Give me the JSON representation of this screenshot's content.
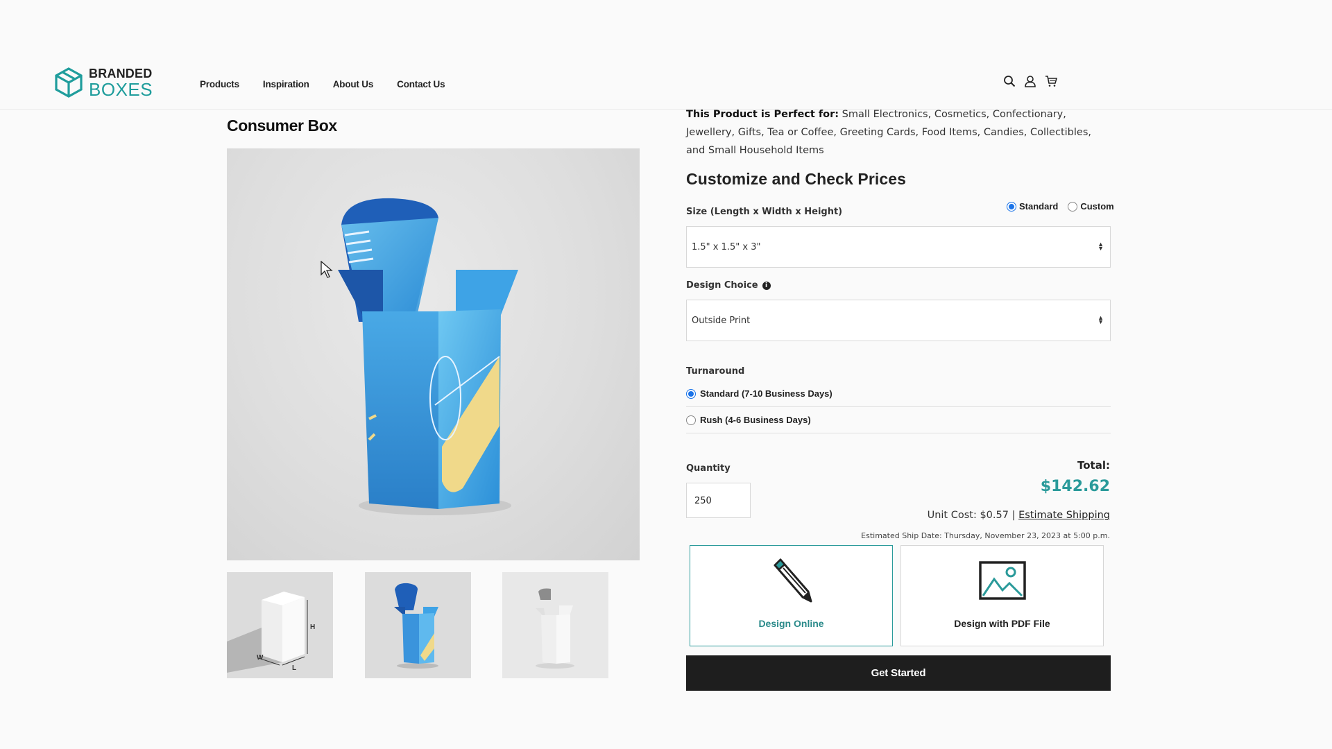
{
  "brand": {
    "line1": "BRANDED",
    "line2": "BOXES",
    "color": "#1f9d9c"
  },
  "nav": {
    "items": [
      "Products",
      "Inspiration",
      "About Us",
      "Contact Us"
    ]
  },
  "header_icons": [
    "search-icon",
    "user-icon",
    "cart-icon"
  ],
  "product": {
    "title": "Consumer Box",
    "thumbnails": [
      "Blank white box with dimension labels",
      "Blue printed box",
      "White open box"
    ],
    "thumb_labels": {
      "h": "H",
      "w": "W",
      "l": "L"
    }
  },
  "perfect_for": {
    "label": "This Product is Perfect for:",
    "text": " Small Electronics, Cosmetics, Confectionary, Jewellery, Gifts, Tea or Coffee, Greeting Cards, Food Items, Candies, Collectibles, and Small Household Items"
  },
  "customize": {
    "heading": "Customize and Check Prices",
    "size_label": "Size (Length x Width x Height)",
    "size_options": {
      "standard": "Standard",
      "custom": "Custom",
      "selected": "standard"
    },
    "size_value": "1.5\" x 1.5\" x 3\"",
    "design_label": "Design Choice",
    "design_value": "Outside Print",
    "turnaround_label": "Turnaround",
    "turnaround_options": [
      {
        "label": "Standard (7-10 Business Days)",
        "selected": true
      },
      {
        "label": "Rush (4-6 Business Days)",
        "selected": false
      }
    ],
    "quantity_label": "Quantity",
    "quantity_value": "250"
  },
  "pricing": {
    "total_label": "Total:",
    "total_value": "$142.62",
    "unit_cost": "Unit Cost: $0.57 |",
    "estimate_link": "Estimate Shipping",
    "ship_date": "Estimated Ship Date: Thursday, November 23, 2023 at 5:00 p.m."
  },
  "design_cards": [
    {
      "label": "Design Online",
      "icon": "pencil-icon",
      "selected": true
    },
    {
      "label": "Design with PDF File",
      "icon": "image-file-icon",
      "selected": false
    }
  ],
  "cta": {
    "label": "Get Started"
  },
  "colors": {
    "accent": "#2a9a9a",
    "radio": "#1a73e8",
    "cta_bg": "#1e1e1e"
  }
}
